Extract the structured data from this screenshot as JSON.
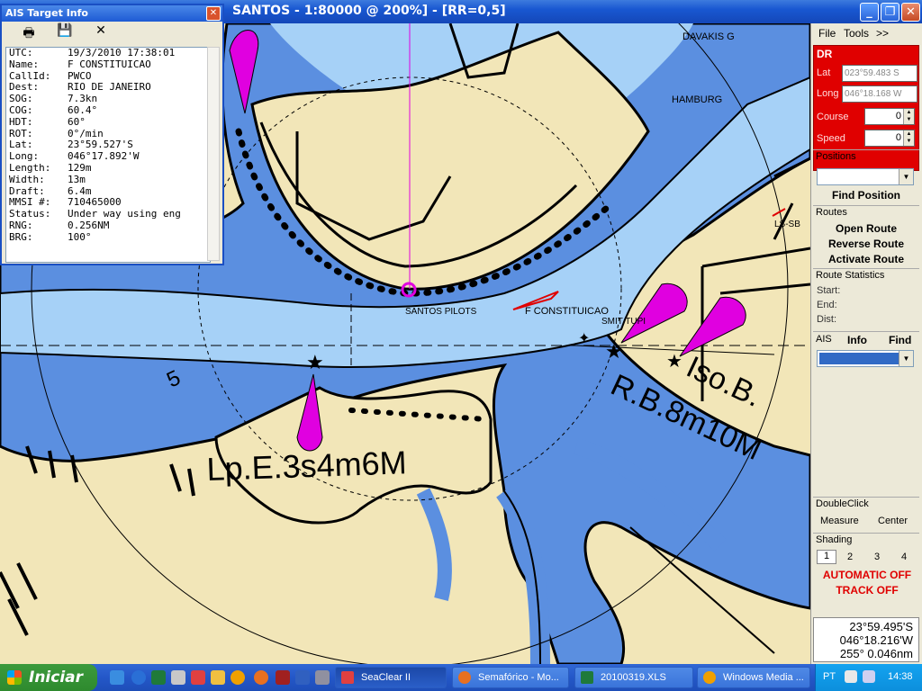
{
  "window": {
    "title": "SANTOS - 1:80000 @ 200%] - [RR=0,5]",
    "min": "_",
    "max": "❐",
    "close": "✕"
  },
  "chart": {
    "labels": {
      "davakis": "DAVAKIS G",
      "hamburg": "HAMBURG",
      "santos_pilots": "SANTOS PILOTS",
      "constituicao": "F CONSTITUICAO",
      "smit_tupi": "SMIT TUPI",
      "light1": "Lp.E.3s4m6M",
      "light2": "R.B.8m10M",
      "light3": "Iso.B.",
      "depth5": "5",
      "edge_right": "LS-SB"
    }
  },
  "panel": {
    "menu": {
      "file": "File",
      "tools": "Tools",
      "more": ">>"
    },
    "dr": {
      "title": "DR",
      "lat_label": "Lat",
      "lat_value": "023°59.483 S",
      "long_label": "Long",
      "long_value": "046°18.168 W",
      "course_label": "Course",
      "course_value": "0",
      "speed_label": "Speed",
      "speed_value": "0"
    },
    "positions": {
      "title": "Positions",
      "find": "Find Position"
    },
    "routes": {
      "title": "Routes",
      "open": "Open Route",
      "reverse": "Reverse Route",
      "activate": "Activate Route"
    },
    "route_stats": {
      "title": "Route Statistics",
      "start": "Start:",
      "end": "End:",
      "dist": "Dist:"
    },
    "ais": {
      "title": "AIS",
      "info": "Info",
      "find": "Find"
    },
    "doubleclick": {
      "title": "DoubleClick",
      "measure": "Measure",
      "center": "Center"
    },
    "shading": {
      "title": "Shading",
      "options": [
        "1",
        "2",
        "3",
        "4"
      ]
    },
    "automatic": "AUTOMATIC OFF",
    "track": "TRACK OFF",
    "readout": {
      "lat": "23°59.495'S",
      "long": "046°18.216'W",
      "brg": "255° 0.046nm"
    }
  },
  "ais_window": {
    "title": "AIS Target Info",
    "close": "✕",
    "tools": {
      "print": "🖶",
      "save": "💾",
      "clear": "✕"
    },
    "rows": [
      {
        "k": "UTC:",
        "v": "19/3/2010 17:38:01"
      },
      {
        "k": "Name:",
        "v": "F CONSTITUICAO"
      },
      {
        "k": "CallId:",
        "v": "PWCO"
      },
      {
        "k": "Dest:",
        "v": "RIO DE JANEIRO"
      },
      {
        "k": "SOG:",
        "v": "7.3kn"
      },
      {
        "k": "COG:",
        "v": "60.4°"
      },
      {
        "k": "HDT:",
        "v": "60°"
      },
      {
        "k": "ROT:",
        "v": "0°/min"
      },
      {
        "k": "Lat:",
        "v": "23°59.527'S"
      },
      {
        "k": "Long:",
        "v": "046°17.892'W"
      },
      {
        "k": "Length:",
        "v": "129m"
      },
      {
        "k": "Width:",
        "v": "13m"
      },
      {
        "k": "Draft:",
        "v": "6.4m"
      },
      {
        "k": "MMSI #:",
        "v": "710465000"
      },
      {
        "k": "Status:",
        "v": "Under way using eng"
      },
      {
        "k": "RNG:",
        "v": "0.256NM"
      },
      {
        "k": "BRG:",
        "v": "100°"
      }
    ]
  },
  "taskbar": {
    "start": "Iniciar",
    "tasks": [
      "SeaClear II",
      "Semafórico - Mo...",
      "20100319.XLS",
      "Windows Media ..."
    ],
    "lang": "PT",
    "clock": "14:38"
  },
  "colors": {
    "land": "#f2e6b8",
    "shallow": "#5b8fe0",
    "deep": "#a6d1f7",
    "ais_target": "#e000e0",
    "panel_dr": "#e00000"
  }
}
